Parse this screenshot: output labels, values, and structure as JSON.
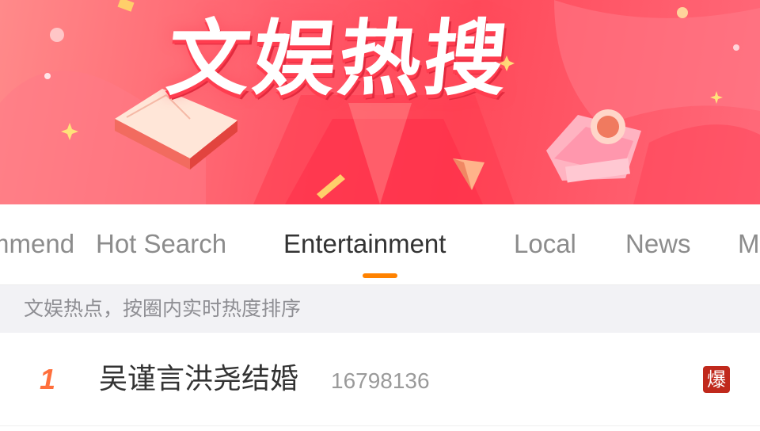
{
  "banner": {
    "title": "文娱热搜"
  },
  "tabs": [
    {
      "label": "Recommend",
      "active": false
    },
    {
      "label": "Hot Search",
      "active": false
    },
    {
      "label": "Entertainment",
      "active": true
    },
    {
      "label": "Local",
      "active": false
    },
    {
      "label": "News",
      "active": false
    },
    {
      "label": "More",
      "active": false
    }
  ],
  "subheader": {
    "text": "文娱热点，按圈内实时热度排序"
  },
  "list": [
    {
      "rank": "1",
      "title": "吴谨言洪尧结婚",
      "count": "16798136",
      "badge": "爆"
    }
  ],
  "colors": {
    "accent": "#ff8200",
    "banner": "#ff5f6d",
    "rank": "#ff6f3c",
    "badge": "#c0291c"
  }
}
